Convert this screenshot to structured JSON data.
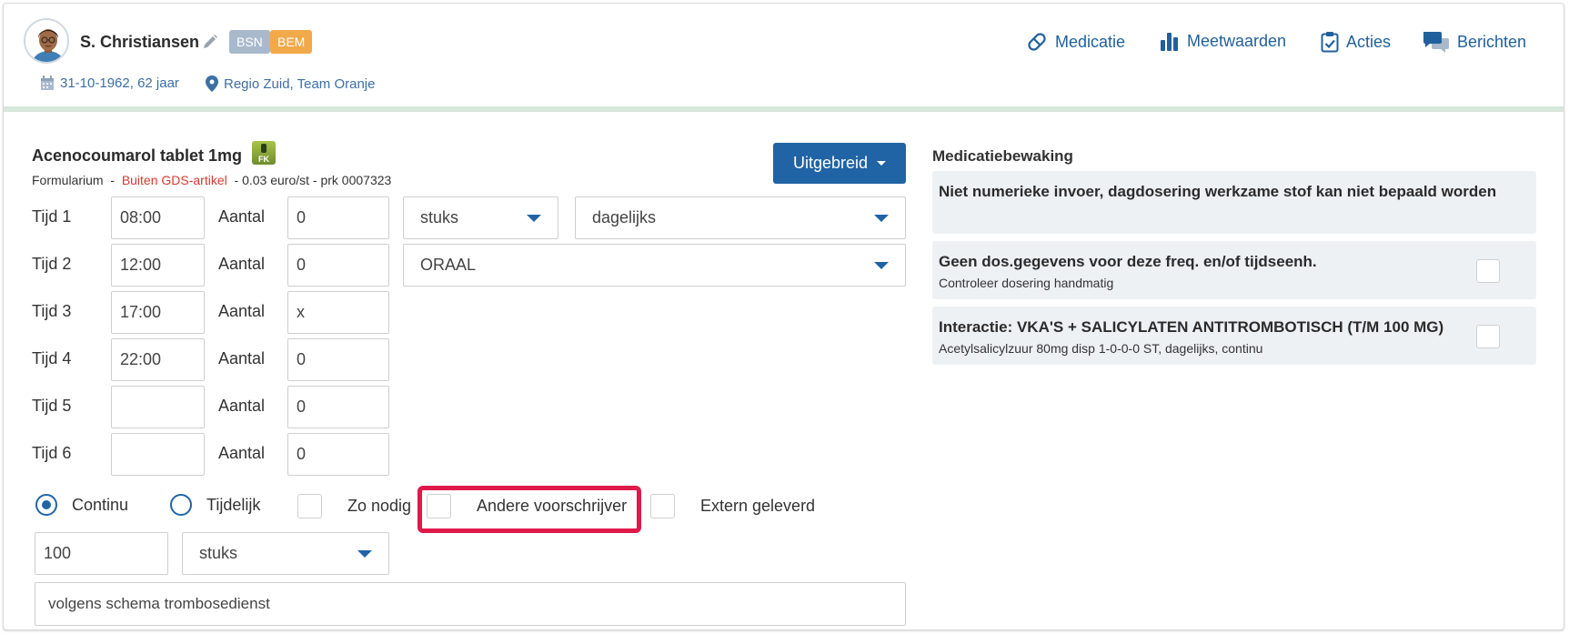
{
  "patient": {
    "name": "S. Christiansen",
    "badges": [
      "BSN",
      "BEM"
    ],
    "dob": "31-10-1962, 62 jaar",
    "region": "Regio Zuid, Team Oranje"
  },
  "nav": {
    "medicatie": "Medicatie",
    "meetwaarden": "Meetwaarden",
    "acties": "Acties",
    "berichten": "Berichten"
  },
  "drug": {
    "title": "Acenocoumarol tablet 1mg",
    "logo_text": "FK",
    "formularium": "Formularium",
    "sep": "-",
    "gds": "Buiten GDS-artikel",
    "price": "- 0.03 euro/st - prk 0007323"
  },
  "uitgebreid_label": "Uitgebreid",
  "schedule": {
    "aantal_label": "Aantal",
    "rows": [
      {
        "label": "Tijd 1",
        "time": "08:00",
        "qty": "0"
      },
      {
        "label": "Tijd 2",
        "time": "12:00",
        "qty": "0"
      },
      {
        "label": "Tijd 3",
        "time": "17:00",
        "qty": "x"
      },
      {
        "label": "Tijd 4",
        "time": "22:00",
        "qty": "0"
      },
      {
        "label": "Tijd 5",
        "time": "",
        "qty": "0"
      },
      {
        "label": "Tijd 6",
        "time": "",
        "qty": "0"
      }
    ]
  },
  "selects": {
    "unit": "stuks",
    "frequency": "dagelijks",
    "route": "ORAAL",
    "total_unit": "stuks"
  },
  "options": {
    "continu": "Continu",
    "tijdelijk": "Tijdelijk",
    "zo_nodig": "Zo nodig",
    "andere": "Andere voorschrijver",
    "extern": "Extern geleverd"
  },
  "total_qty": "100",
  "notes": "volgens schema trombosedienst",
  "bewaking": {
    "title": "Medicatiebewaking",
    "items": [
      {
        "head": "Niet numerieke invoer, dagdosering werkzame stof kan niet bepaald worden",
        "sub": ""
      },
      {
        "head": "Geen dos.gegevens voor deze freq. en/of tijdseenh.",
        "sub": "Controleer dosering handmatig"
      },
      {
        "head": "Interactie: VKA'S + SALICYLATEN ANTITROMBOTISCH (T/M 100 MG)",
        "sub": "Acetylsalicylzuur 80mg disp 1-0-0-0 ST, dagelijks, continu"
      }
    ]
  },
  "colors": {
    "primary": "#2064a5",
    "highlight": "#e0194b",
    "badge_bsn": "#a9b9cc",
    "badge_bem": "#f2a94a",
    "warning_text": "#d63a2f"
  }
}
